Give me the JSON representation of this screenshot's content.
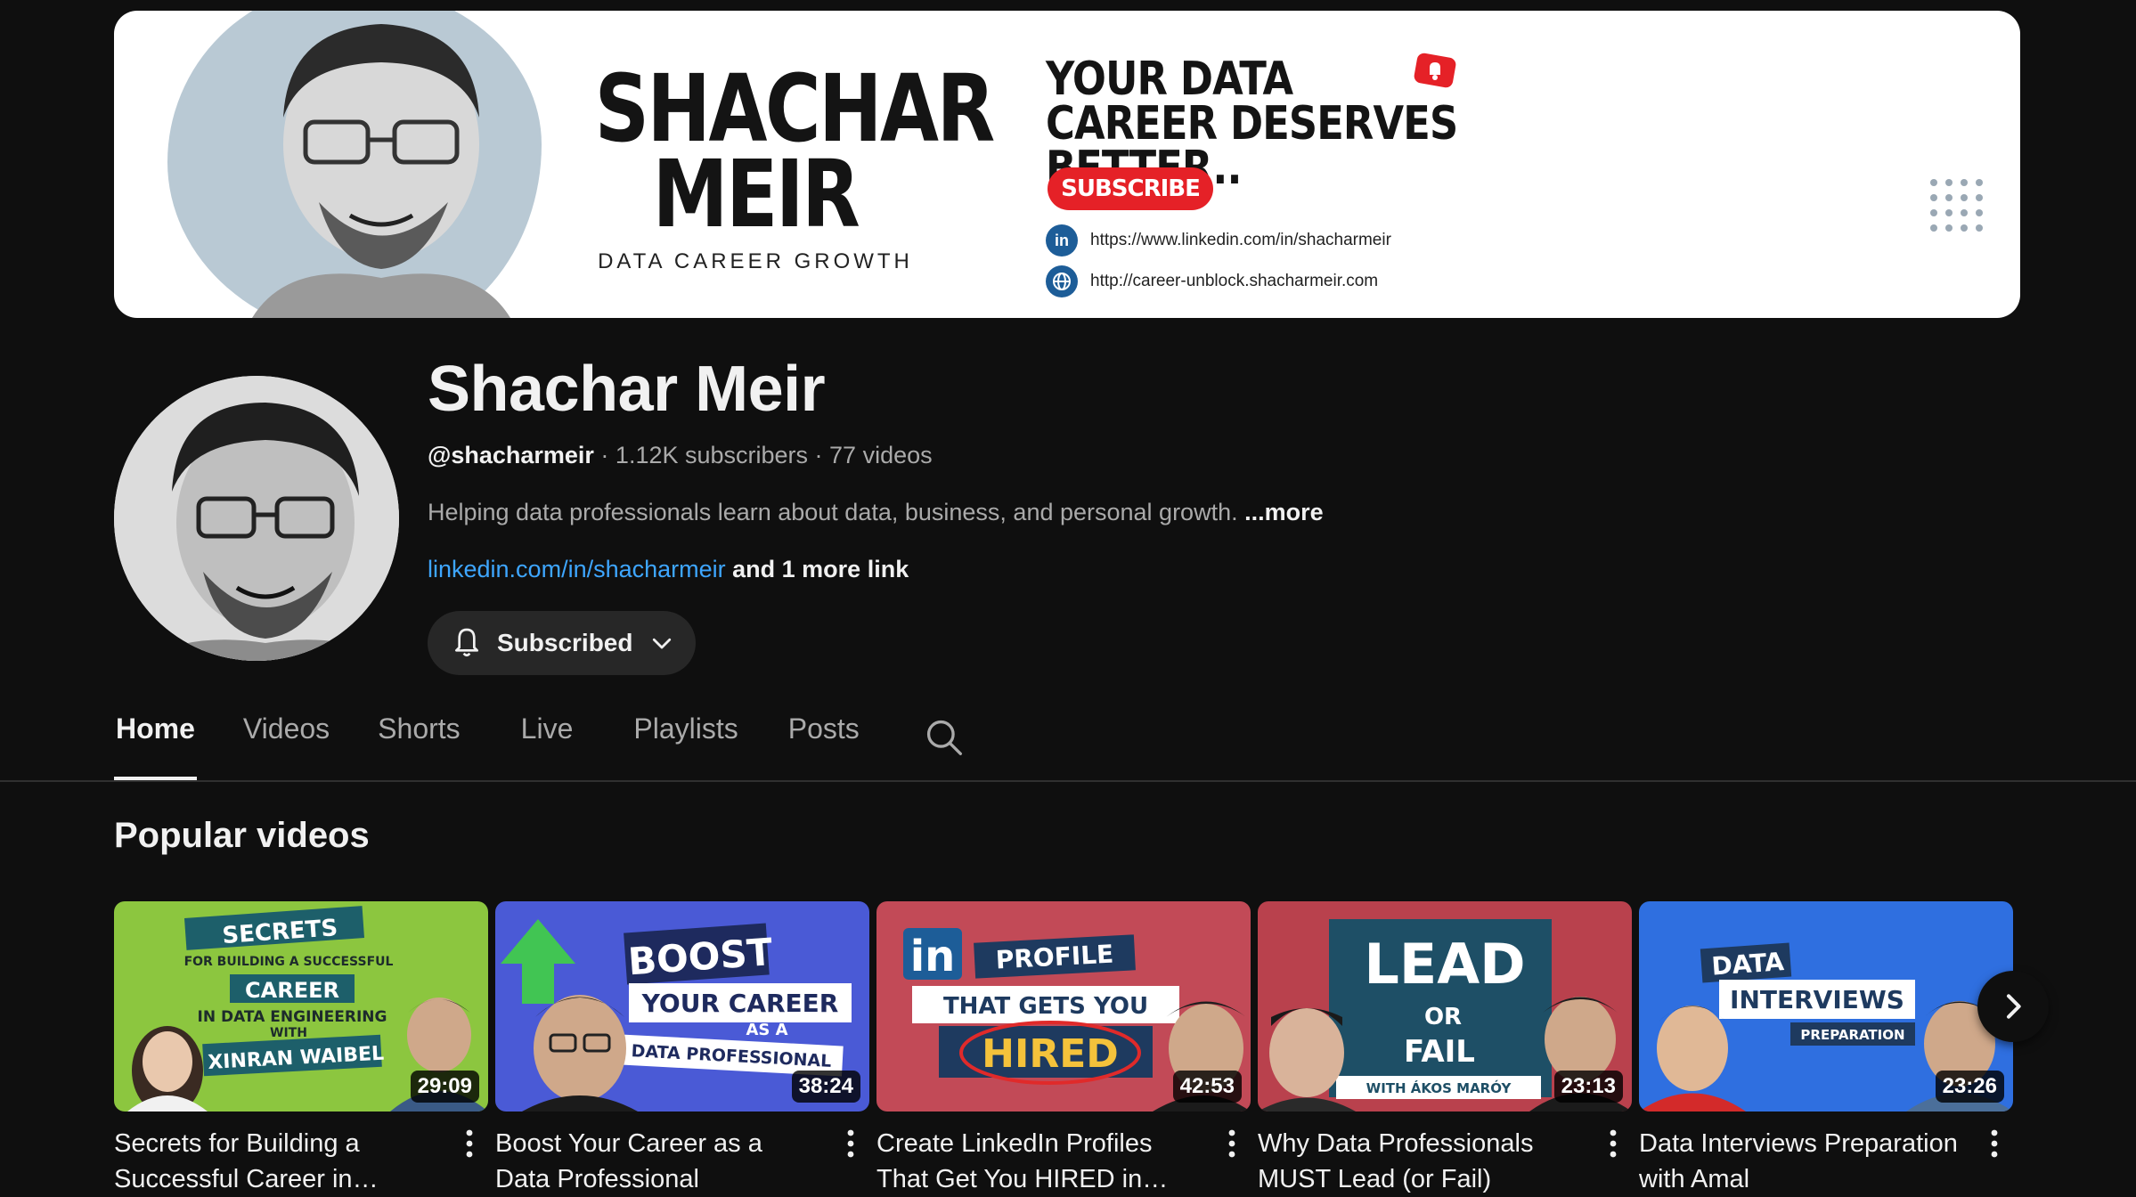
{
  "banner": {
    "name_line1": "SHACHAR",
    "name_line2": "MEIR",
    "tagline": "DATA CAREER GROWTH",
    "headline_line1": "YOUR DATA",
    "headline_line2": "CAREER DESERVES BETTER..",
    "subscribe_label": "SUBSCRIBE",
    "link1": "https://www.linkedin.com/in/shacharmeir",
    "link2": "http://career-unblock.shacharmeir.com",
    "linkedin_icon": "in"
  },
  "channel": {
    "name": "Shachar Meir",
    "handle": "@shacharmeir",
    "subscribers": "1.12K subscribers",
    "videos": "77 videos",
    "separator": " · ",
    "description": "Helping data professionals learn about data, business, and personal growth.",
    "more_label": "...more",
    "link": "linkedin.com/in/shacharmeir",
    "more_links": "and 1 more link",
    "subscribed_label": "Subscribed"
  },
  "tabs": [
    {
      "label": "Home",
      "active": true
    },
    {
      "label": "Videos",
      "active": false
    },
    {
      "label": "Shorts",
      "active": false
    },
    {
      "label": "Live",
      "active": false
    },
    {
      "label": "Playlists",
      "active": false
    },
    {
      "label": "Posts",
      "active": false
    }
  ],
  "section_title": "Popular videos",
  "videos": [
    {
      "title": "Secrets for Building a Successful Career in Data…",
      "duration": "29:09",
      "thumb_text": [
        "SECRETS",
        "FOR BUILDING A SUCCESSFUL",
        "CAREER",
        "IN DATA ENGINEERING",
        "WITH",
        "XINRAN WAIBEL"
      ],
      "bg": "#8cc63f"
    },
    {
      "title": "Boost Your Career as a Data Professional",
      "duration": "38:24",
      "thumb_text": [
        "BOOST",
        "YOUR CAREER",
        "AS A",
        "DATA PROFESSIONAL"
      ],
      "bg": "#4a5ad6"
    },
    {
      "title": "Create LinkedIn Profiles That Get You HIRED in Data",
      "duration": "42:53",
      "thumb_text": [
        "in",
        "PROFILE",
        "THAT GETS YOU",
        "HIRED"
      ],
      "bg": "#c24a57"
    },
    {
      "title": "Why Data Professionals MUST Lead (or Fail)",
      "duration": "23:13",
      "thumb_text": [
        "LEAD",
        "OR",
        "FAIL",
        "WITH ÁKOS MARÓY"
      ],
      "bg": "#b9414d"
    },
    {
      "title": "Data Interviews Preparation with Amal",
      "duration": "23:26",
      "thumb_text": [
        "DATA",
        "INTERVIEWS",
        "PREPARATION"
      ],
      "bg": "#2f6fe0"
    }
  ],
  "icons": {
    "bell": "bell-icon",
    "chevron": "chevron-down-icon",
    "search": "search-icon",
    "next": "chevron-right-icon",
    "kebab": "more-vert-icon"
  }
}
